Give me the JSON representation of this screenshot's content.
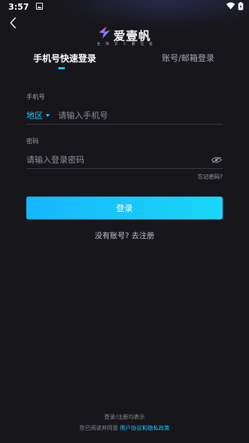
{
  "status_bar": {
    "time": "3:57",
    "icons": [
      "image-notification-icon",
      "wifi-icon",
      "battery-charging-icon"
    ]
  },
  "header": {
    "back_icon": "chevron-left-icon",
    "logo_text": "爱壹帆",
    "logo_slogan": "全 球 华 人 都 在 看"
  },
  "tabs": [
    {
      "label": "手机号快速登录",
      "active": true
    },
    {
      "label": "账号/邮箱登录",
      "active": false
    }
  ],
  "phone_field": {
    "label": "手机号",
    "region_label": "地区",
    "placeholder": "请输入手机号",
    "value": ""
  },
  "password_field": {
    "label": "密码",
    "placeholder": "请输入登录密码",
    "value": "",
    "toggle_icon": "eye-icon"
  },
  "forgot_password": "忘记密码?",
  "login_button": "登录",
  "register_link": "没有账号? 去注册",
  "footer": {
    "line1": "登录/注册均表示",
    "line2_prefix": "您已阅读并同意",
    "agreement_link": "用户协议和隐私政策"
  },
  "colors": {
    "background": "#17161b",
    "accent": "#1ec8ff",
    "button_gradient_start": "#17b6ff",
    "button_gradient_end": "#1ad6f7"
  }
}
